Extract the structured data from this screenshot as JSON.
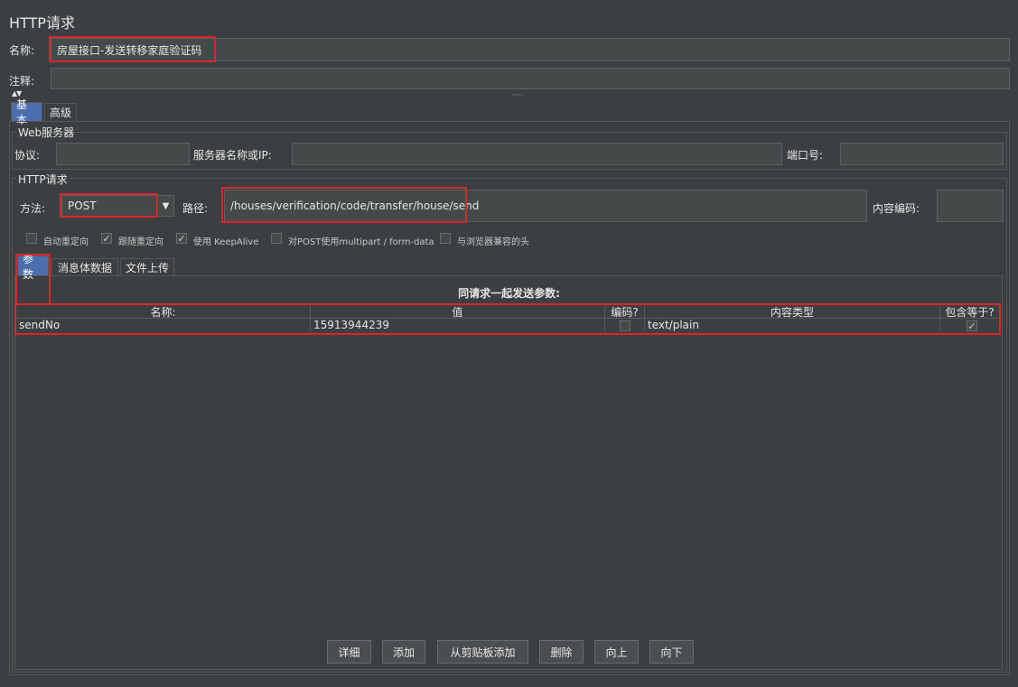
{
  "header": {
    "title": "HTTP请求"
  },
  "name_field": {
    "label": "名称:",
    "value": "房屋接口-发送转移家庭验证码"
  },
  "comment_field": {
    "label": "注释:",
    "value": ""
  },
  "tabs": [
    {
      "label": "基本"
    },
    {
      "label": "高级"
    }
  ],
  "web_server": {
    "legend": "Web服务器",
    "protocol_label": "协议:",
    "protocol_value": "",
    "server_label": "服务器名称或IP:",
    "server_value": "",
    "port_label": "端口号:",
    "port_value": ""
  },
  "http_request": {
    "legend": "HTTP请求",
    "method_label": "方法:",
    "method_value": "POST",
    "path_label": "路径:",
    "path_value": "/houses/verification/code/transfer/house/send",
    "encoding_label": "内容编码:",
    "encoding_value": ""
  },
  "options": [
    {
      "label": "自动重定向",
      "checked": false
    },
    {
      "label": "跟随重定向",
      "checked": true
    },
    {
      "label": "使用 KeepAlive",
      "checked": true
    },
    {
      "label": "对POST使用multipart / form-data",
      "checked": false
    },
    {
      "label": "与浏览器兼容的头",
      "checked": false
    }
  ],
  "subtabs": [
    {
      "label": "参数"
    },
    {
      "label": "消息体数据"
    },
    {
      "label": "文件上传"
    }
  ],
  "params": {
    "title": "同请求一起发送参数:",
    "columns": [
      "名称:",
      "值",
      "编码?",
      "内容类型",
      "包含等于?"
    ],
    "rows": [
      {
        "name": "sendNo",
        "value": "15913944239",
        "encode": false,
        "content_type": "text/plain",
        "include_equals": true
      }
    ]
  },
  "buttons": {
    "detail": "详细",
    "add": "添加",
    "add_clipboard": "从剪贴板添加",
    "delete": "删除",
    "up": "向上",
    "down": "向下"
  },
  "colors": {
    "accent": "#4b6eaf",
    "highlight": "#d9262c",
    "background": "#3c3f41"
  }
}
